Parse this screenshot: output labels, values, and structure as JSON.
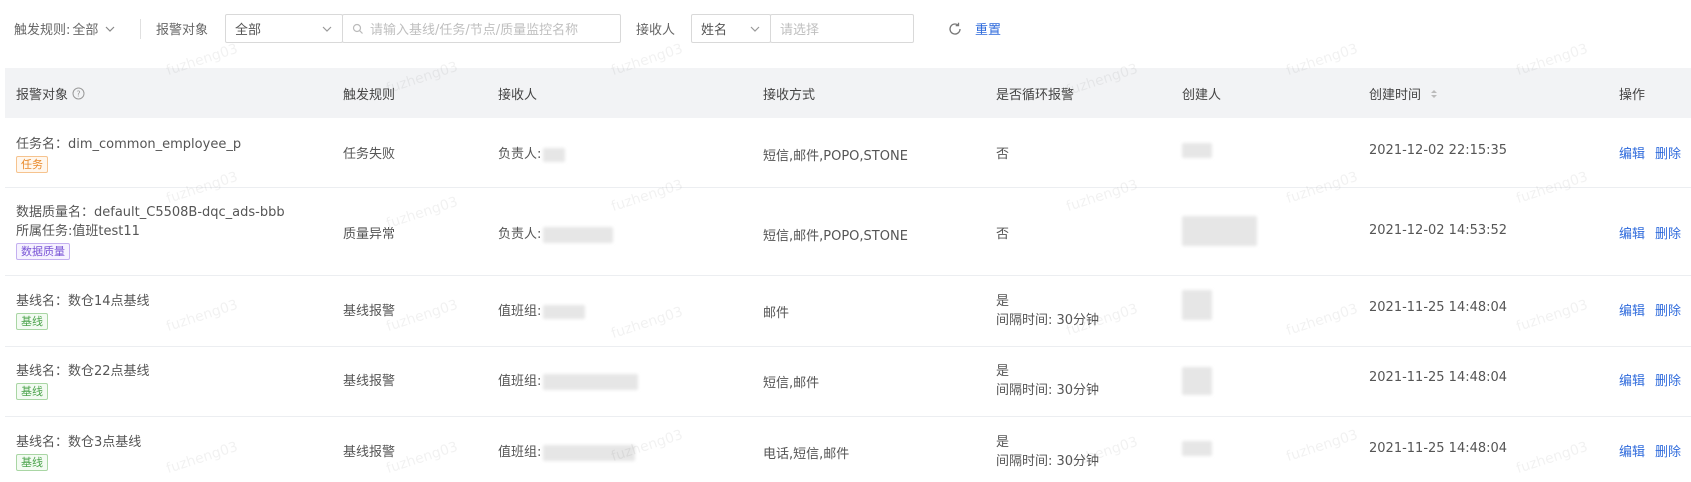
{
  "filters": {
    "trigger_rule_label": "触发规则:",
    "trigger_rule_value": "全部",
    "alert_target_label": "报警对象",
    "alert_target_select": "全部",
    "search_placeholder": "请输入基线/任务/节点/质量监控名称",
    "receiver_label": "接收人",
    "receiver_type_select": "姓名",
    "receiver_placeholder": "请选择",
    "reset_label": "重置"
  },
  "table": {
    "headers": {
      "target": "报警对象",
      "rule": "触发规则",
      "receiver": "接收人",
      "method": "接收方式",
      "loop": "是否循环报警",
      "creator": "创建人",
      "created_at": "创建时间",
      "ops": "操作"
    },
    "rows": [
      {
        "target_line1": "任务名：dim_common_employee_p",
        "target_line2": "",
        "tag": "任务",
        "rule": "任务失败",
        "receiver_prefix": "负责人:",
        "method": "短信,邮件,POPO,STONE",
        "loop": "否",
        "loop_interval": "",
        "created_at": "2021-12-02 22:15:35",
        "edit": "编辑",
        "delete": "删除"
      },
      {
        "target_line1": "数据质量名：default_C5508B-dqc_ads-bbb",
        "target_line2": "所属任务:值班test11",
        "tag": "数据质量",
        "rule": "质量异常",
        "receiver_prefix": "负责人:",
        "method": "短信,邮件,POPO,STONE",
        "loop": "否",
        "loop_interval": "",
        "created_at": "2021-12-02 14:53:52",
        "edit": "编辑",
        "delete": "删除"
      },
      {
        "target_line1": "基线名：数仓14点基线",
        "target_line2": "",
        "tag": "基线",
        "rule": "基线报警",
        "receiver_prefix": "值班组:",
        "method": "邮件",
        "loop": "是",
        "loop_interval": "间隔时间: 30分钟",
        "created_at": "2021-11-25 14:48:04",
        "edit": "编辑",
        "delete": "删除"
      },
      {
        "target_line1": "基线名：数仓22点基线",
        "target_line2": "",
        "tag": "基线",
        "rule": "基线报警",
        "receiver_prefix": "值班组:",
        "method": "短信,邮件",
        "loop": "是",
        "loop_interval": "间隔时间: 30分钟",
        "created_at": "2021-11-25 14:48:04",
        "edit": "编辑",
        "delete": "删除"
      },
      {
        "target_line1": "基线名：数仓3点基线",
        "target_line2": "",
        "tag": "基线",
        "rule": "基线报警",
        "receiver_prefix": "值班组:",
        "method": "电话,短信,邮件",
        "loop": "是",
        "loop_interval": "间隔时间: 30分钟",
        "created_at": "2021-11-25 14:48:04",
        "edit": "编辑",
        "delete": "删除"
      }
    ]
  },
  "watermark_text": "fuzheng03",
  "colors": {
    "link": "#2f6bdc",
    "header_bg": "#f2f3f5",
    "tag_task": "#e8892a",
    "tag_quality": "#7a55d6",
    "tag_baseline": "#4ca34c"
  }
}
